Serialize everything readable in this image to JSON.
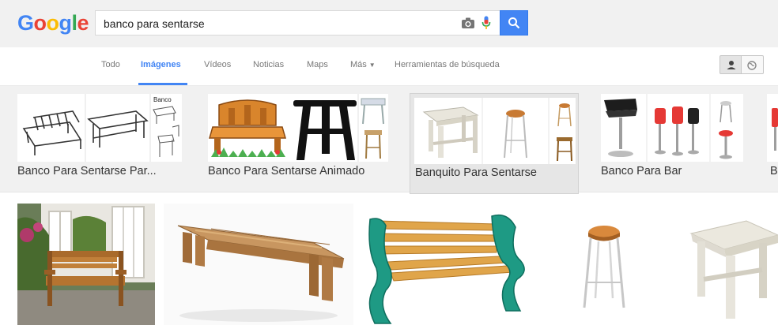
{
  "logo": {
    "letters": [
      "G",
      "o",
      "o",
      "g",
      "l",
      "e"
    ],
    "colors": [
      "#4285f4",
      "#ea4335",
      "#fbbc05",
      "#4285f4",
      "#34a853",
      "#ea4335"
    ]
  },
  "search": {
    "value": "banco para sentarse",
    "button_color": "#4285f4"
  },
  "tabs": [
    {
      "label": "Todo",
      "active": false
    },
    {
      "label": "Imágenes",
      "active": true
    },
    {
      "label": "Vídeos",
      "active": false
    },
    {
      "label": "Noticias",
      "active": false
    },
    {
      "label": "Maps",
      "active": false
    },
    {
      "label": "Más",
      "active": false
    },
    {
      "label": "Herramientas de búsqueda",
      "active": false
    }
  ],
  "related": [
    {
      "label": "Banco Para Sentarse Par...",
      "thumb_text": "Banco"
    },
    {
      "label": "Banco Para Sentarse Animado"
    },
    {
      "label": "Banquito Para Sentarse",
      "selected": true
    },
    {
      "label": "Banco Para Bar"
    },
    {
      "label": "B"
    }
  ],
  "icons": {
    "camera": "camera-icon",
    "mic": "mic-icon",
    "search": "search-icon",
    "person": "person-icon",
    "globe": "globe-icon"
  }
}
